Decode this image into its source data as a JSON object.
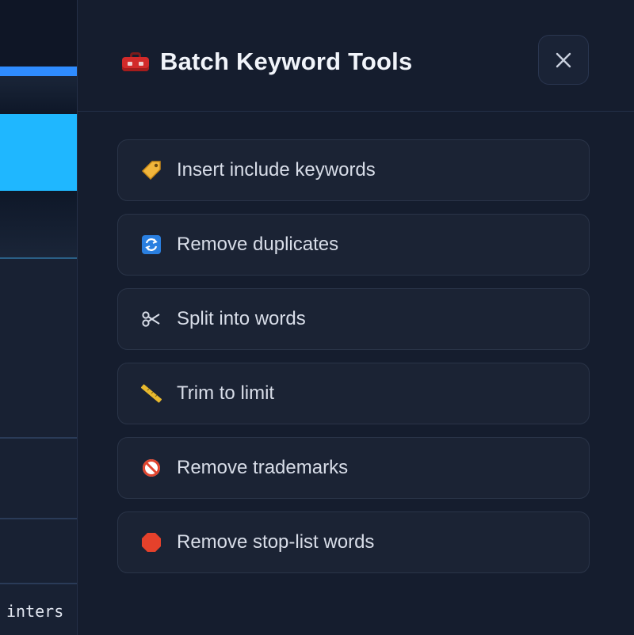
{
  "background": {
    "code_text": "inters"
  },
  "panel": {
    "title": "Batch Keyword Tools",
    "title_icon": "toolbox-icon",
    "close_icon": "close-icon"
  },
  "tools": [
    {
      "label": "Insert include keywords",
      "icon": "label-tag-icon"
    },
    {
      "label": "Remove duplicates",
      "icon": "repeat-arrows-icon"
    },
    {
      "label": "Split into words",
      "icon": "scissors-icon"
    },
    {
      "label": "Trim to limit",
      "icon": "ruler-icon"
    },
    {
      "label": "Remove trademarks",
      "icon": "prohibited-icon"
    },
    {
      "label": "Remove stop-list words",
      "icon": "stop-sign-icon"
    }
  ],
  "colors": {
    "panel_bg": "#151d2e",
    "item_bg": "#1b2334",
    "accent_blue": "#2f8cff",
    "accent_cyan": "#1fb7ff"
  }
}
